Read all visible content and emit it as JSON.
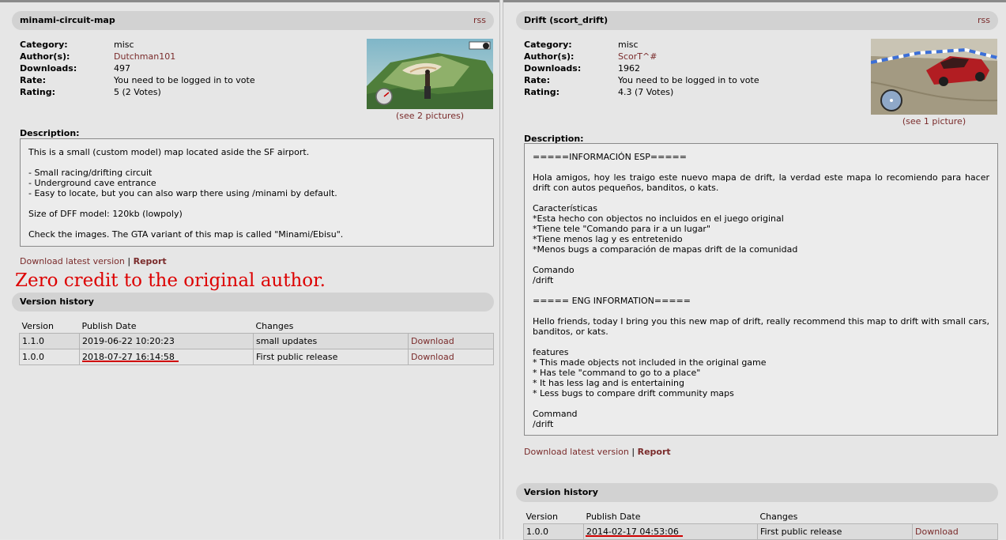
{
  "left": {
    "title": "minami-circuit-map",
    "rss": "rss",
    "info": [
      {
        "label": "Category:",
        "value": "misc",
        "link": false
      },
      {
        "label": "Author(s):",
        "value": "Dutchman101",
        "link": true
      },
      {
        "label": "Downloads:",
        "value": "497",
        "link": false
      },
      {
        "label": "Rate:",
        "value": "You need to be logged in to vote",
        "link": false
      },
      {
        "label": "Rating:",
        "value": "5 (2 Votes)",
        "link": false
      }
    ],
    "see_pictures": "(see 2 pictures)",
    "description_label": "Description:",
    "description": [
      "This is a small (custom model) map located aside the SF airport.",
      "- Small racing/drifting circuit\n- Underground cave entrance\n- Easy to locate, but you can also warp there using /minami by default.",
      "Size of DFF model: 120kb (lowpoly)",
      "Check the images. The GTA variant of this map is called \"Minami/Ebisu\"."
    ],
    "download_latest": "Download latest version",
    "separator": "|",
    "report": "Report",
    "annotation": "Zero credit to the original author.",
    "version_history": "Version history",
    "columns": [
      "Version",
      "Publish Date",
      "Changes",
      ""
    ],
    "versions": [
      {
        "version": "1.1.0",
        "date": "2019-06-22 10:20:23",
        "changes": "small updates",
        "download": "Download"
      },
      {
        "version": "1.0.0",
        "date": "2018-07-27 16:14:58",
        "changes": "First public release",
        "download": "Download"
      }
    ]
  },
  "right": {
    "title": "Drift (scort_drift)",
    "rss": "rss",
    "info": [
      {
        "label": "Category:",
        "value": "misc",
        "link": false
      },
      {
        "label": "Author(s):",
        "value": "ScorT^#",
        "link": true
      },
      {
        "label": "Downloads:",
        "value": "1962",
        "link": false
      },
      {
        "label": "Rate:",
        "value": "You need to be logged in to vote",
        "link": false
      },
      {
        "label": "Rating:",
        "value": "4.3 (7 Votes)",
        "link": false
      }
    ],
    "see_pictures": "(see 1 picture)",
    "description_label": "Description:",
    "description": [
      "=====INFORMACIÓN ESP=====",
      "Hola amigos, hoy les traigo este nuevo mapa de drift, la verdad este mapa lo recomiendo para hacer drift con autos pequeños, banditos, o kats.",
      "Características\n*Esta hecho con objectos no incluidos en el juego original\n*Tiene tele \"Comando para ir a un lugar\"\n*Tiene menos lag y es entretenido\n*Menos bugs a comparación de mapas drift de la comunidad",
      "Comando\n/drift",
      "===== ENG INFORMATION=====",
      "Hello friends, today I bring you this new map of drift, really recommend this map to drift with small cars, banditos, or kats.",
      "features\n* This made objects not included in the original game\n* Has tele \"command to go to a place\"\n* It has less lag and is entertaining\n* Less bugs to compare drift community maps",
      "Command\n/drift"
    ],
    "download_latest": "Download latest version",
    "separator": "|",
    "report": "Report",
    "version_history": "Version history",
    "columns": [
      "Version",
      "Publish Date",
      "Changes",
      ""
    ],
    "versions": [
      {
        "version": "1.0.0",
        "date": "2014-02-17 04:53:06",
        "changes": "First public release",
        "download": "Download"
      }
    ]
  },
  "colors": {
    "link": "#7a2b2b",
    "annotation": "#dd0000",
    "underline": "#d00000"
  }
}
